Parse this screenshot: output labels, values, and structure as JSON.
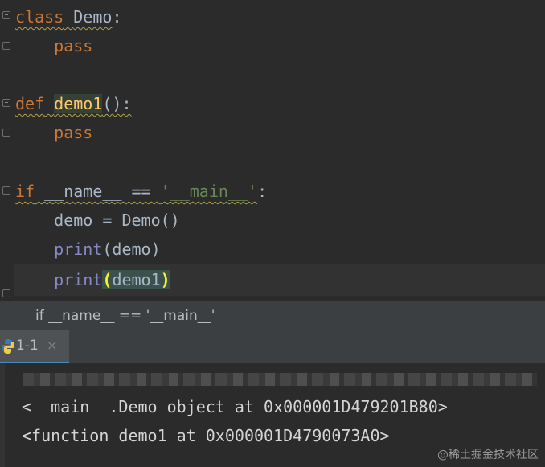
{
  "editor": {
    "lines": [
      {
        "parts": [
          [
            "kw",
            "class"
          ],
          [
            "plain",
            " "
          ],
          [
            "plain",
            "Demo"
          ],
          [
            "plain",
            ":"
          ]
        ]
      },
      {
        "parts": [
          [
            "plain",
            "    "
          ],
          [
            "kw",
            "pass"
          ]
        ]
      },
      {
        "parts": []
      },
      {
        "parts": [
          [
            "kw",
            "def"
          ],
          [
            "plain",
            " "
          ],
          [
            "fn",
            "demo1"
          ],
          [
            "plain",
            "():"
          ]
        ]
      },
      {
        "parts": [
          [
            "plain",
            "    "
          ],
          [
            "kw",
            "pass"
          ]
        ]
      },
      {
        "parts": []
      },
      {
        "parts": [
          [
            "kw",
            "if"
          ],
          [
            "plain",
            " __name__ == "
          ],
          [
            "str",
            "'__main__'"
          ],
          [
            "plain",
            ":"
          ]
        ]
      },
      {
        "parts": [
          [
            "plain",
            "    demo = Demo()"
          ]
        ]
      },
      {
        "parts": [
          [
            "plain",
            "    "
          ],
          [
            "builtin",
            "print"
          ],
          [
            "plain",
            "(demo)"
          ]
        ]
      },
      {
        "parts": [
          [
            "plain",
            "    "
          ],
          [
            "builtin",
            "print"
          ],
          [
            "brace",
            "("
          ],
          [
            "plain",
            "demo1"
          ],
          [
            "brace",
            ")"
          ]
        ]
      }
    ]
  },
  "code": {
    "l1_kw": "class",
    "l1_name": "Demo",
    "l1_colon": ":",
    "l2_kw": "pass",
    "l4_kw": "def",
    "l4_name": "demo1",
    "l4_rest": "():",
    "l5_kw": "pass",
    "l7_kw": "if",
    "l7_mid": " __name__ == ",
    "l7_str": "'__main__'",
    "l7_colon": ":",
    "l8": "demo = Demo()",
    "l9_fn": "print",
    "l9_rest": "(demo)",
    "l10_fn": "print",
    "l10_open": "(",
    "l10_arg": "demo1",
    "l10_close": ")"
  },
  "breadcrumb": {
    "text": "if __name__ == '__main__'"
  },
  "run_tab": {
    "label": "1-1",
    "close": "×",
    "icon": "python-icon"
  },
  "console": {
    "output": [
      "<__main__.Demo object at 0x000001D479201B80>",
      "<function demo1 at 0x000001D4790073A0>"
    ]
  },
  "watermark": "@稀土掘金技术社区",
  "colors": {
    "background": "#2b2b2b",
    "keyword": "#cc7832",
    "function": "#ffc66d",
    "string": "#6a8759",
    "builtin": "#8888c6",
    "text": "#a9b7c6"
  }
}
